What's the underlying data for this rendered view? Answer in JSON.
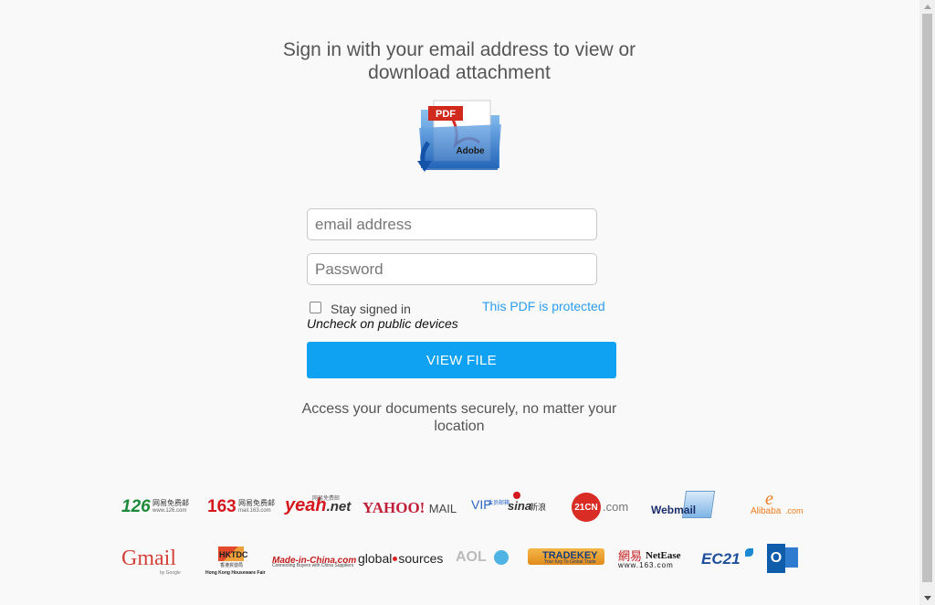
{
  "header": {
    "title": "Sign in with your email address to view or download attachment"
  },
  "pdf_icon": {
    "badge": "PDF",
    "label": "Adobe"
  },
  "form": {
    "email_placeholder": "email address",
    "password_placeholder": "Password",
    "stay_signed_in": "Stay signed in",
    "stay_signed_in_checked": false,
    "uncheck_note": "Uncheck on public devices",
    "protected_link": "This PDF is protected",
    "submit_label": "VIEW FILE"
  },
  "tagline": "Access your documents securely, no matter your location",
  "providers_row1": {
    "p126": {
      "main": "126",
      "cn": "网易免费邮",
      "sub": "www.126.com"
    },
    "p163": {
      "main": "163",
      "cn": "网易免费邮",
      "sub": "mail.163.com"
    },
    "yeah": {
      "main": "yeah",
      "tld": ".net",
      "cn": "网易免费邮"
    },
    "yahoo": {
      "main": "YAHOO!",
      "sub": "MAIL"
    },
    "sina": {
      "vip": "VIP",
      "vip_cn": "会员邮箱",
      "main": "sina",
      "cn": "新浪"
    },
    "c21": {
      "main": "21CN",
      "tld": ".com"
    },
    "webmail": {
      "main": "Webmail"
    },
    "alibaba": {
      "main": "Alibaba",
      "tld": ".com"
    }
  },
  "providers_row2": {
    "gmail": {
      "main": "Gmail",
      "sub": "by Google"
    },
    "hktdc": {
      "main": "HKTDC",
      "cn": "香港貿發局",
      "sub": "Hong Kong Houseware Fair"
    },
    "madeinchina": {
      "main": "Made-in-China.com",
      "sub": "Connecting Buyers with China Suppliers"
    },
    "globalsources": {
      "main": "global",
      "tail": "sources"
    },
    "aol": {
      "main": "AOL"
    },
    "tradekey": {
      "main": "TRADEKEY",
      "sub": "Your Key To Global Trade"
    },
    "netease": {
      "cn": "網易",
      "main": "NetEase",
      "sub": "www.163.com"
    },
    "ec21": {
      "main": "EC21"
    },
    "outlook": {
      "main": "O"
    }
  },
  "colors": {
    "accent": "#0fa1f2",
    "link": "#2a9df4",
    "background": "#f9f9f9"
  }
}
